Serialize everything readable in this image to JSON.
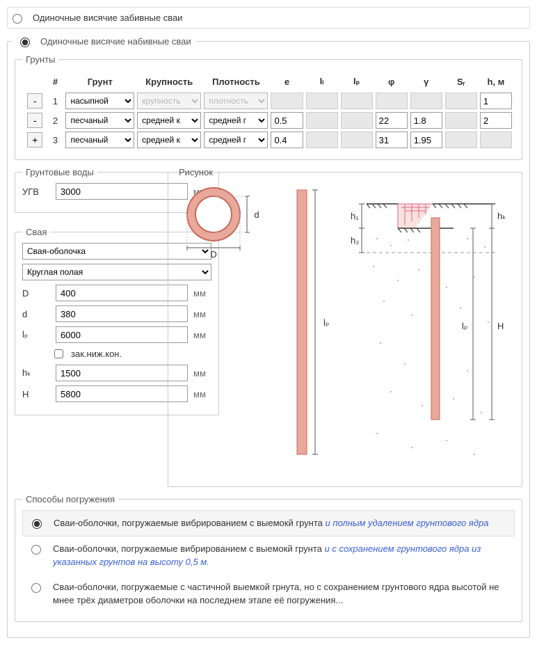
{
  "type_options": {
    "driven": "Одиночные висячие забивные сваи",
    "bored": "Одиночные висячие набивные сваи"
  },
  "soils": {
    "legend": "Грунты",
    "headers": {
      "num": "#",
      "soil": "Грунт",
      "grain": "Крупность",
      "density": "Плотность",
      "e": "e",
      "il": "Iₗ",
      "ip": "Iₚ",
      "phi": "φ",
      "gamma": "γ",
      "sr": "Sᵣ",
      "h": "h, м"
    },
    "btn_minus": "-",
    "btn_plus": "+",
    "rows": [
      {
        "n": "1",
        "soil": "насыпной",
        "grain": "крупность",
        "density": "плотность",
        "grain_disabled": true,
        "density_disabled": true,
        "e": "",
        "il": "",
        "ip": "",
        "phi": "",
        "gamma": "",
        "sr": "",
        "h": "1",
        "e_dis": true,
        "il_dis": true,
        "ip_dis": true,
        "phi_dis": true,
        "gamma_dis": true,
        "sr_dis": true
      },
      {
        "n": "2",
        "soil": "песчаный",
        "grain": "средней к",
        "density": "средней г",
        "e": "0.5",
        "il": "",
        "ip": "",
        "phi": "22",
        "gamma": "1.8",
        "sr": "",
        "h": "2",
        "il_dis": true,
        "ip_dis": true,
        "sr_dis": true
      },
      {
        "n": "3",
        "soil": "песчаный",
        "grain": "средней к",
        "density": "средней г",
        "e": "0.4",
        "il": "",
        "ip": "",
        "phi": "31",
        "gamma": "1.95",
        "sr": "",
        "h": "",
        "il_dis": true,
        "ip_dis": true,
        "sr_dis": true,
        "h_dis": true
      }
    ]
  },
  "water": {
    "legend": "Грунтовые воды",
    "label": "УГВ",
    "value": "3000",
    "unit": "мм"
  },
  "pile": {
    "legend": "Свая",
    "type1": "Свая-оболочка",
    "type2": "Круглая полая",
    "D_lab": "D",
    "D_val": "400",
    "d_lab": "d",
    "d_val": "380",
    "lp_lab": "lₚ",
    "lp_val": "6000",
    "chk": "зак.ниж.кон.",
    "hk_lab": "hₖ",
    "hk_val": "1500",
    "H_lab": "H",
    "H_val": "5800",
    "unit": "мм"
  },
  "drawing": {
    "legend": "Рисунок",
    "D": "D",
    "d": "d",
    "lp": "lₚ",
    "h1": "h₁",
    "h2": "h₂",
    "hk": "hₖ",
    "H": "H"
  },
  "methods": {
    "legend": "Способы погружения",
    "items": [
      {
        "main": "Сваи-оболочки, погружаемые вибрированием с выемокй грунта ",
        "em": "и полным удалением грунтового ядра"
      },
      {
        "main": "Сваи-оболочки, погружаемые вибрированием с выемокй грунта ",
        "em": "и с сохранением грунтового ядра из указанных грунтов на высоту 0,5 м."
      },
      {
        "main": "Сваи-оболочки, погружаемые с частичной выемкой грнута, но с сохранением грунтового ядра высотой не мнее трёх диаметров оболочки на последнем этапе её погружения...",
        "em": ""
      }
    ]
  }
}
